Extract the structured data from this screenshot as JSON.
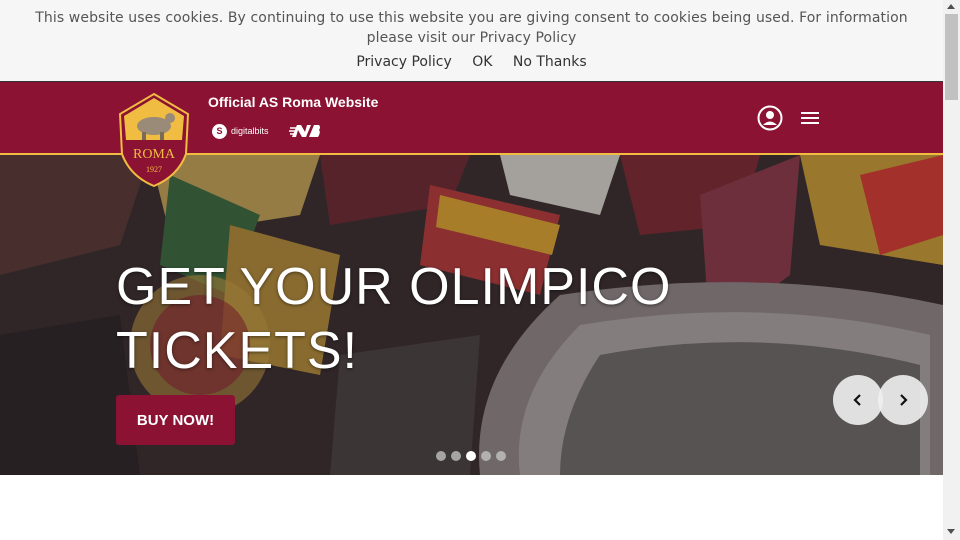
{
  "cookie_bar": {
    "message": "This website uses cookies. By continuing to use this website you are giving consent to cookies being used. For information please visit our Privacy Policy",
    "privacy_link": "Privacy Policy",
    "ok_button": "OK",
    "no_thanks_button": "No Thanks"
  },
  "header": {
    "site_title": "Official AS Roma Website",
    "crest_text": "ROMA",
    "crest_year": "1927",
    "sponsor_digitalbits": "digitalbits",
    "sponsor_newbalance_icon": "new-balance-logo",
    "user_icon": "user-icon",
    "menu_icon": "hamburger-menu-icon"
  },
  "hero": {
    "title_line1": "GET YOUR OLIMPICO",
    "title_line2": "TICKETS!",
    "cta_label": "BUY NOW!",
    "slide_count": 5,
    "active_slide": 3
  },
  "colors": {
    "brand_red": "#8b1232",
    "brand_gold": "#f0bc42",
    "cookie_bg": "#f6f6f6"
  }
}
